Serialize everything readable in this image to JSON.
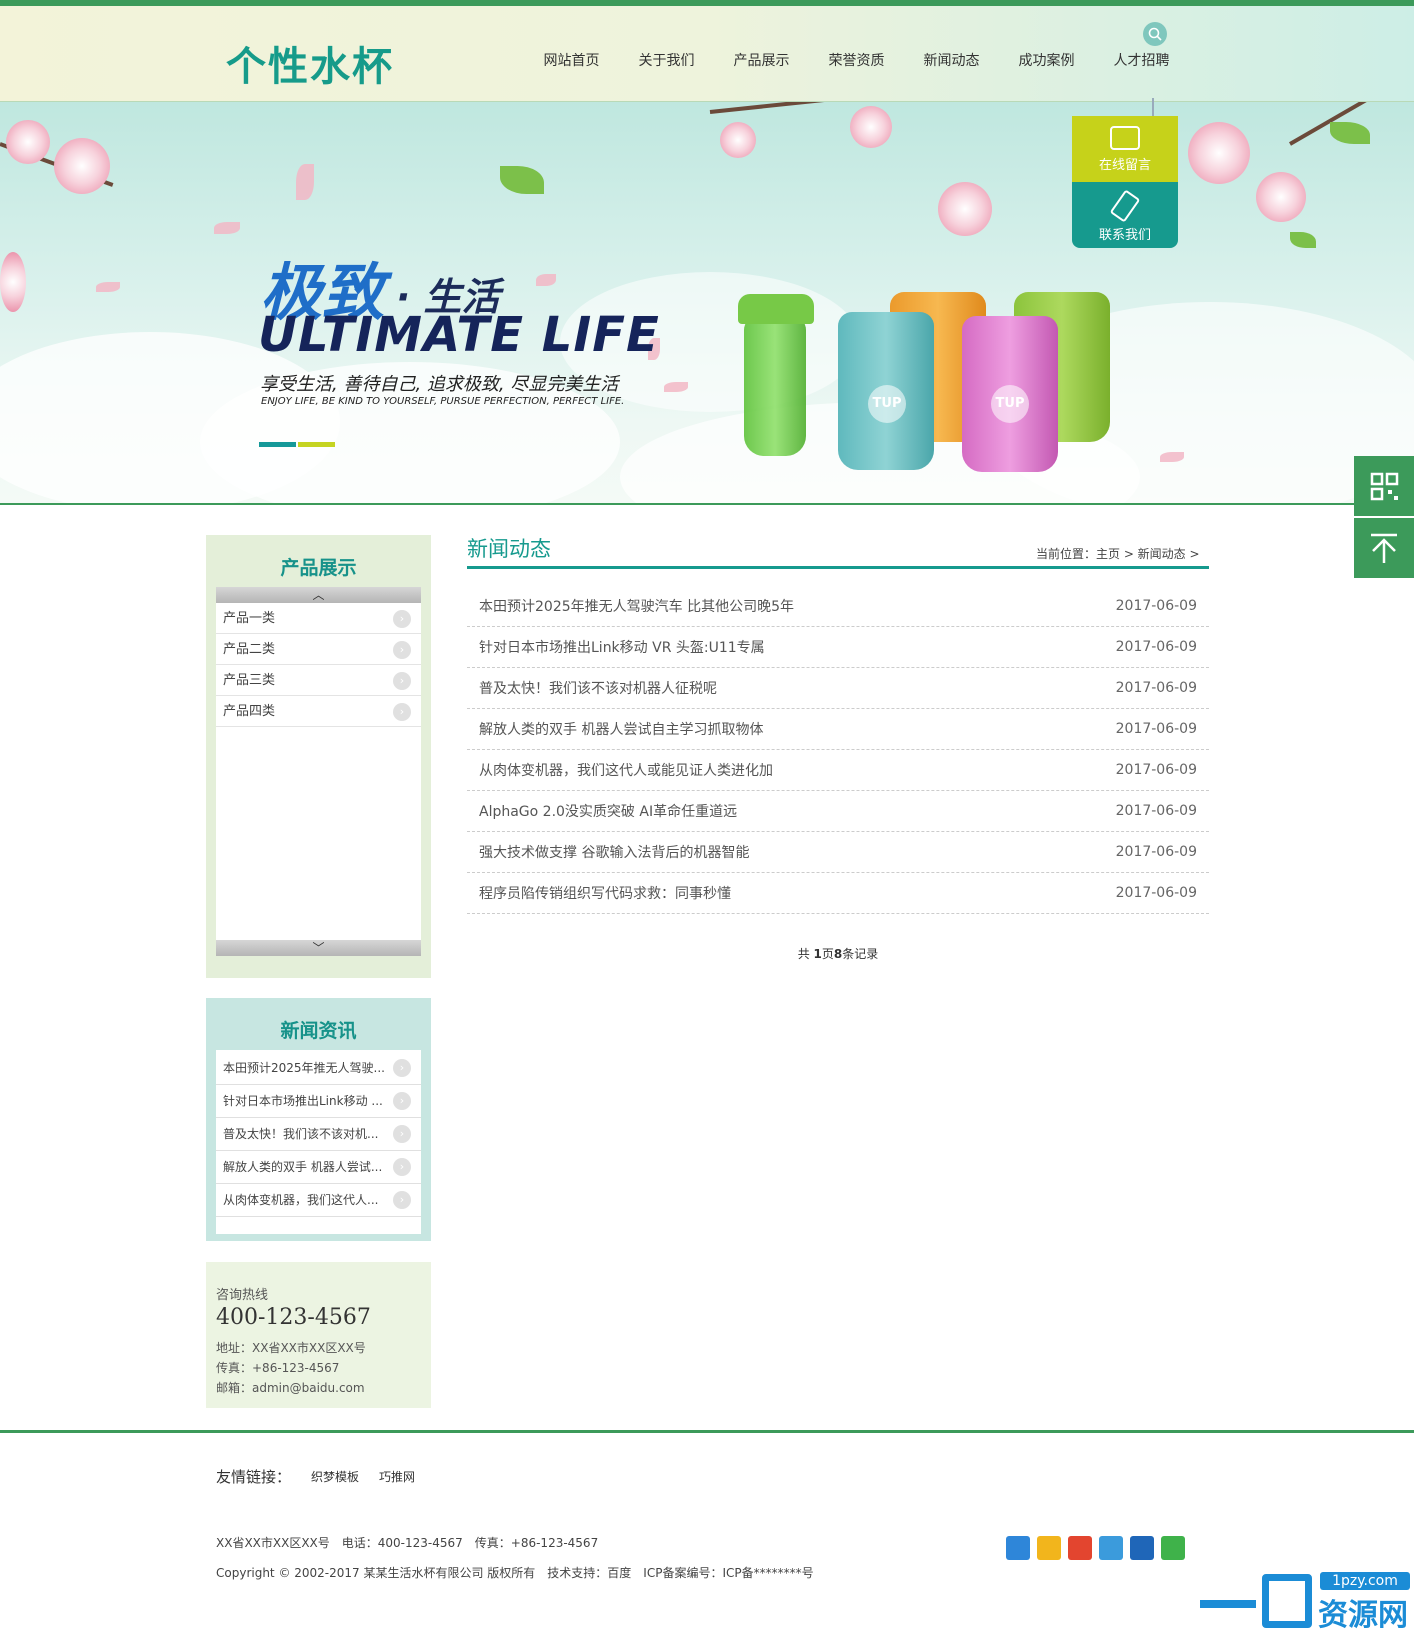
{
  "brand": {
    "logo_text": "个性水杯"
  },
  "nav": {
    "items": [
      "网站首页",
      "关于我们",
      "产品展示",
      "荣誉资质",
      "新闻动态",
      "成功案例",
      "人才招聘"
    ]
  },
  "banner": {
    "title_cn_1": "极致",
    "title_cn_2": "· 生活",
    "title_en": "ULTIMATE  LIFE",
    "subtitle_cn": "享受生活, 善待自己, 追求极致, 尽显完美生活",
    "subtitle_en": "ENJOY LIFE, BE KIND TO YOURSELF, PURSUE PERFECTION, PERFECT LIFE.",
    "cup_badge": "TUP"
  },
  "float_panel": {
    "message_label": "在线留言",
    "contact_label": "联系我们"
  },
  "sidebar": {
    "products_title": "产品展示",
    "products": [
      "产品一类",
      "产品二类",
      "产品三类",
      "产品四类"
    ],
    "news_title": "新闻资讯",
    "news": [
      "本田预计2025年推无人驾驶...",
      "针对日本市场推出Link移动 ...",
      "普及太快！我们该不该对机...",
      "解放人类的双手 机器人尝试...",
      "从肉体变机器，我们这代人..."
    ],
    "contact": {
      "hotline_label": "咨询热线",
      "hotline": "400-123-4567",
      "address": "地址：XX省XX市XX区XX号",
      "fax": "传真：+86-123-4567",
      "email": "邮箱：admin@baidu.com"
    }
  },
  "main": {
    "title": "新闻动态",
    "breadcrumb": "当前位置：主页 > 新闻动态 >",
    "articles": [
      {
        "title": "本田预计2025年推无人驾驶汽车 比其他公司晚5年",
        "date": "2017-06-09"
      },
      {
        "title": "针对日本市场推出Link移动 VR 头盔:U11专属",
        "date": "2017-06-09"
      },
      {
        "title": "普及太快！我们该不该对机器人征税呢",
        "date": "2017-06-09"
      },
      {
        "title": "解放人类的双手 机器人尝试自主学习抓取物体",
        "date": "2017-06-09"
      },
      {
        "title": "从肉体变机器，我们这代人或能见证人类进化加",
        "date": "2017-06-09"
      },
      {
        "title": "AlphaGo 2.0没实质突破 AI革命任重道远",
        "date": "2017-06-09"
      },
      {
        "title": "强大技术做支撑 谷歌输入法背后的机器智能",
        "date": "2017-06-09"
      },
      {
        "title": "程序员陷传销组织写代码求救：同事秒懂",
        "date": "2017-06-09"
      }
    ],
    "pager": {
      "prefix": "共 ",
      "pages": "1",
      "middle": "页",
      "records": "8",
      "suffix": "条记录"
    }
  },
  "footer": {
    "links_label": "友情链接：",
    "links": [
      "织梦模板",
      "巧推网"
    ],
    "address_line": "XX省XX市XX区XX号　电话：400-123-4567　传真：+86-123-4567",
    "copyright_line": "Copyright © 2002-2017 某某生活水杯有限公司 版权所有　技术支持：百度　ICP备案编号：ICP备********号"
  },
  "watermark": {
    "url": "1pzy.com",
    "text": "资源网"
  },
  "colors": {
    "primary_green": "#3c9a5a",
    "teal": "#169a8e",
    "lime": "#c6d21a",
    "sidebar_light_green": "#e4efd9",
    "sidebar_light_teal": "#c7e6e1"
  }
}
